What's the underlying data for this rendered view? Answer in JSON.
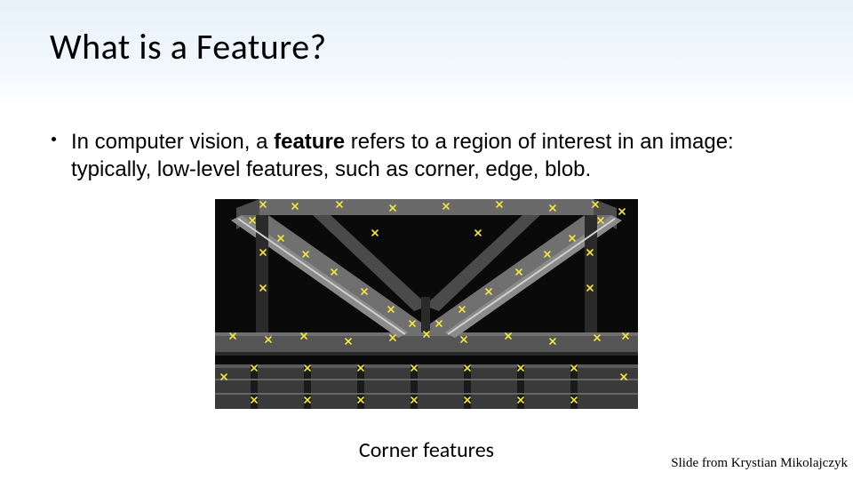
{
  "title": "What is a Feature?",
  "bullet": {
    "pre": "In computer vision, a ",
    "bold": "feature",
    "post": " refers to a region of interest in an image: typically, low-level features, such as corner, edge, blob."
  },
  "caption": "Corner features",
  "attribution": "Slide from Krystian Mikolajczyk",
  "figure": {
    "alt": "grayscale photo of steel beams with yellow x markers at detected corners"
  }
}
